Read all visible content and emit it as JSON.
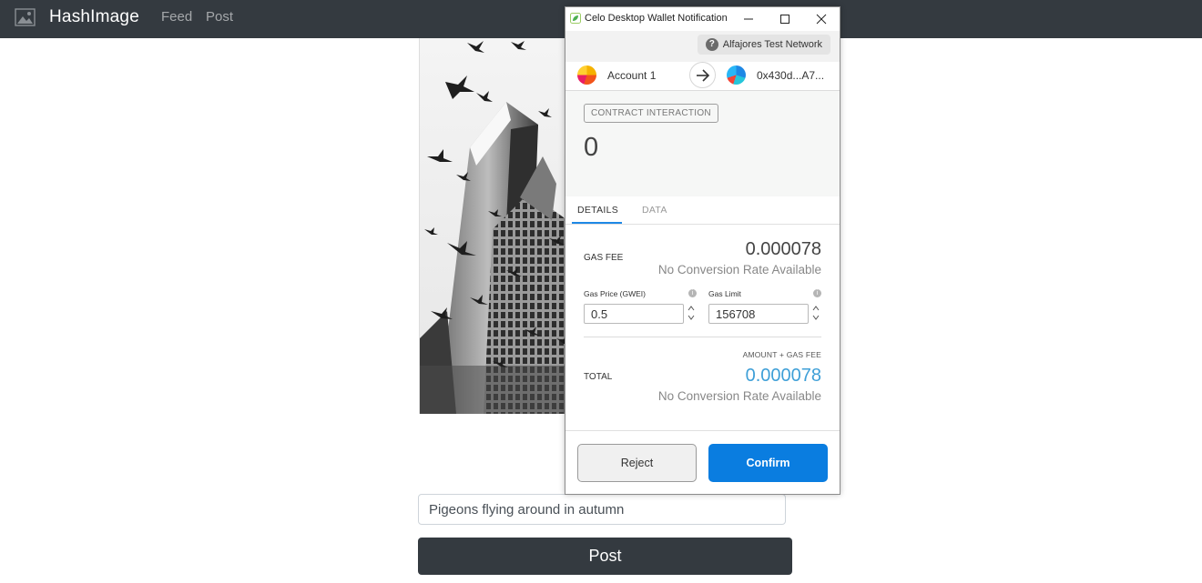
{
  "app": {
    "brand": "HashImage",
    "nav": {
      "feed": "Feed",
      "post": "Post"
    }
  },
  "composer": {
    "caption_value": "Pigeons flying around in autumn",
    "post_label": "Post"
  },
  "wallet": {
    "window_title": "Celo Desktop Wallet Notification",
    "network": "Alfajores Test Network",
    "from_account": "Account 1",
    "to_address": "0x430d...A7...",
    "badge": "CONTRACT INTERACTION",
    "amount": "0",
    "tabs": {
      "details": "DETAILS",
      "data": "DATA"
    },
    "active_tab": "DETAILS",
    "gas_fee": {
      "label": "GAS FEE",
      "value": "0.000078",
      "conversion": "No Conversion Rate Available"
    },
    "gas_price": {
      "label": "Gas Price (GWEI)",
      "value": "0.5"
    },
    "gas_limit": {
      "label": "Gas Limit",
      "value": "156708"
    },
    "total": {
      "caption": "AMOUNT + GAS FEE",
      "label": "TOTAL",
      "value": "0.000078",
      "conversion": "No Conversion Rate Available"
    },
    "buttons": {
      "reject": "Reject",
      "confirm": "Confirm"
    },
    "colors": {
      "confirm": "#0a7de0",
      "total_value": "#3e9fd7",
      "tab_active": "#1e88e5"
    }
  }
}
